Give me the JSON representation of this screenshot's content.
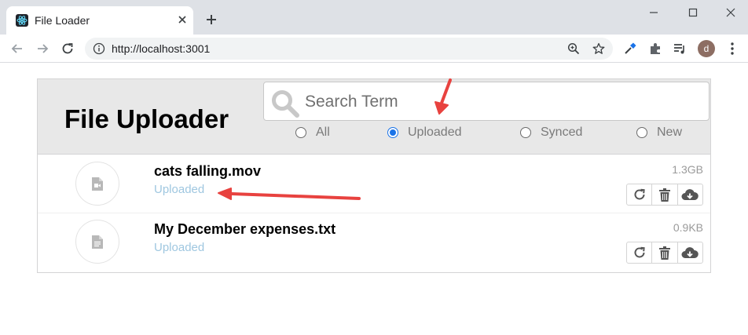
{
  "browser": {
    "tab_title": "File Loader",
    "url": "http://localhost:3001",
    "profile_initial": "d"
  },
  "app": {
    "title": "File Uploader",
    "search": {
      "placeholder": "Search Term",
      "value": ""
    },
    "filters": [
      {
        "label": "All",
        "checked": false
      },
      {
        "label": "Uploaded",
        "checked": true
      },
      {
        "label": "Synced",
        "checked": false
      },
      {
        "label": "New",
        "checked": false
      }
    ],
    "files": [
      {
        "name": "cats falling.mov",
        "status": "Uploaded",
        "size": "1.3GB",
        "icon": "video-file-icon"
      },
      {
        "name": "My December expenses.txt",
        "status": "Uploaded",
        "size": "0.9KB",
        "icon": "text-file-icon"
      }
    ],
    "row_actions": [
      "refresh-icon",
      "trash-icon",
      "cloud-download-icon"
    ]
  },
  "colors": {
    "status_text": "#9fc7e0",
    "annotation_arrow": "#e8423f",
    "radio_selected": "#1a73e8"
  }
}
